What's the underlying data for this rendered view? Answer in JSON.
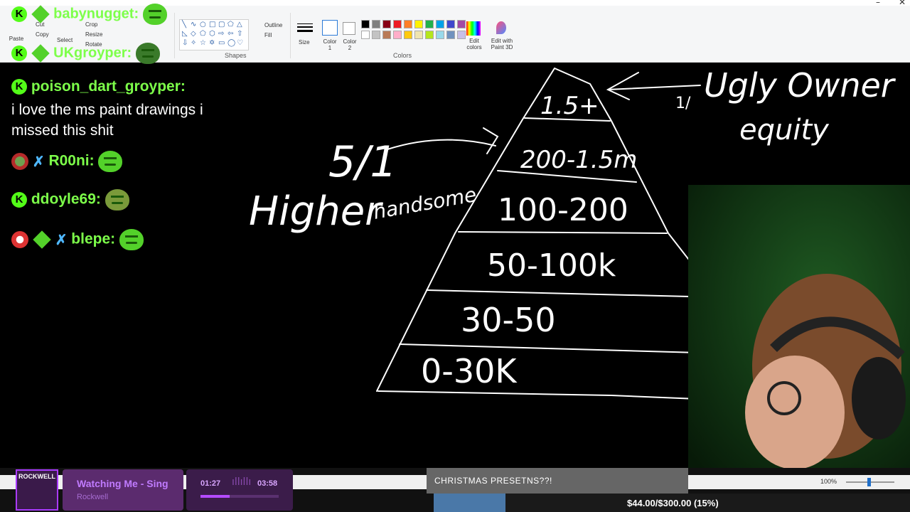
{
  "paint": {
    "groups": {
      "shapes": "Shapes",
      "colors": "Colors"
    },
    "clipboard": {
      "paste": "Paste",
      "cut": "Cut",
      "copy": "Copy"
    },
    "image": {
      "select": "Select",
      "crop": "Crop",
      "resize": "Resize",
      "rotate": "Rotate"
    },
    "shape_opts": {
      "outline": "Outline",
      "fill": "Fill"
    },
    "size_label": "Size",
    "color1_label": "Color 1",
    "color2_label": "Color 2",
    "edit_colors": "Edit colors",
    "edit_3d": "Edit with Paint 3D",
    "palette_row1": [
      "#000000",
      "#7f7f7f",
      "#880015",
      "#ed1c24",
      "#ff7f27",
      "#fff200",
      "#22b14c",
      "#00a2e8",
      "#3f48cc",
      "#a349a4"
    ],
    "palette_row2": [
      "#ffffff",
      "#c3c3c3",
      "#b97a57",
      "#ffaec9",
      "#ffc90e",
      "#efe4b0",
      "#b5e61d",
      "#99d9ea",
      "#7092be",
      "#c8bfe7"
    ]
  },
  "chat": {
    "top_users": [
      "babynugget:",
      "UKgroyper:"
    ],
    "messages": [
      {
        "user": "poison_dart_groyper:",
        "text_line1": "i love the ms paint drawings i",
        "text_line2": "missed this shit"
      },
      {
        "user": "R00ni:"
      },
      {
        "user": "ddoyle69:"
      },
      {
        "user": "blepe:"
      }
    ]
  },
  "drawing": {
    "tiers": [
      "1.5+",
      "200-1.5m",
      "100-200",
      "50-100k",
      "30-50",
      "0-30K"
    ],
    "left_text_1": "5/1",
    "left_text_2": "Higher",
    "left_text_3": "handsome",
    "right_text_1": "Ugly Owner",
    "right_text_2": "equity",
    "right_text_3": "1/"
  },
  "music": {
    "title": "Watching Me - Sing",
    "artist": "Rockwell",
    "elapsed": "01:27",
    "total": "03:58",
    "thumb_label": "ROCKWELL",
    "progress": 0.37
  },
  "stream": {
    "ticker": "CHRISTMAS PRESETNS??!",
    "donation": "$44.00/$300.00 (15%)",
    "donation_progress": 0.15,
    "zoom": "100%"
  }
}
